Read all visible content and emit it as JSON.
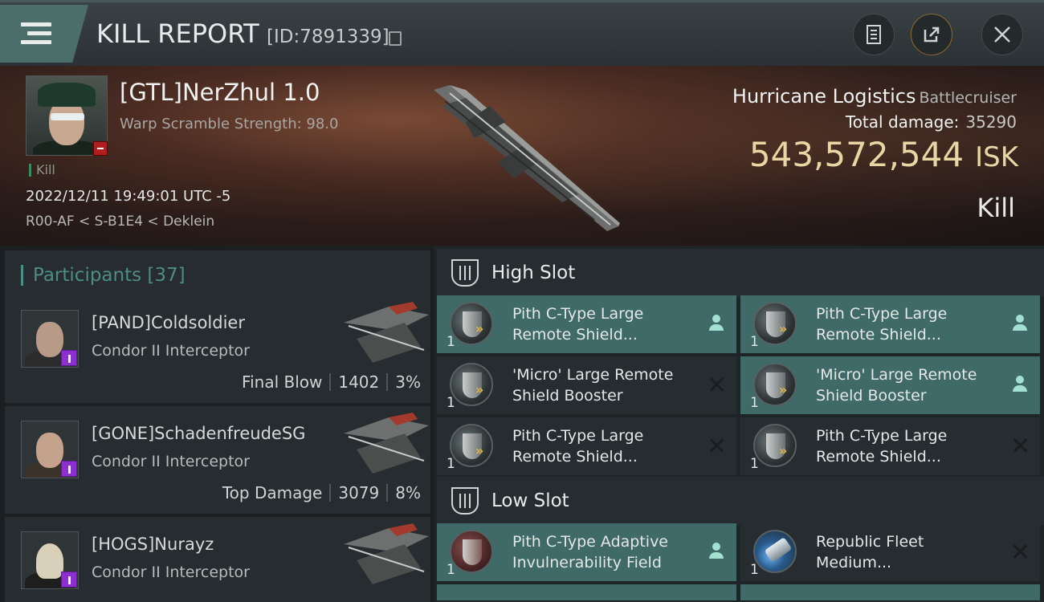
{
  "header": {
    "title": "KILL REPORT",
    "report_id": "[ID:7891339]",
    "buttons": [
      "clipboard-icon",
      "share-icon",
      "close-icon"
    ]
  },
  "victim": {
    "name": "[GTL]NerZhul 1.0",
    "subtitle": "Warp Scramble Strength: 98.0",
    "tag": "Kill",
    "datetime": "2022/12/11 19:49:01 UTC -5",
    "location": "R00-AF < S-B1E4 < Deklein",
    "ship_name": "Hurricane Logistics",
    "ship_class": "Battlecruiser",
    "total_damage_label": "Total damage:",
    "total_damage": "35290",
    "isk_value": "543,572,544",
    "isk_unit": "ISK",
    "result": "Kill"
  },
  "participants": {
    "label": "Participants",
    "count": "[37]",
    "rows": [
      {
        "name": "[PAND]Coldsoldier",
        "ship": "Condor II Interceptor",
        "stat_label": "Final Blow",
        "damage": "1402",
        "percent": "3%"
      },
      {
        "name": "[GONE]SchadenfreudeSG",
        "ship": "Condor II Interceptor",
        "stat_label": "Top Damage",
        "damage": "3079",
        "percent": "8%"
      },
      {
        "name": "[HOGS]Nurayz",
        "ship": "Condor II Interceptor",
        "stat_label": "",
        "damage": "",
        "percent": ""
      }
    ]
  },
  "modules": {
    "high_slot_label": "High Slot",
    "low_slot_label": "Low Slot",
    "high": [
      {
        "qty": "1",
        "line1": "Pith C-Type Large",
        "line2": "Remote Shield...",
        "status": "dropped",
        "icon": "shield-booster-icon"
      },
      {
        "qty": "1",
        "line1": "Pith C-Type Large",
        "line2": "Remote Shield...",
        "status": "dropped",
        "icon": "shield-booster-icon"
      },
      {
        "qty": "1",
        "line1": "'Micro' Large Remote",
        "line2": "Shield Booster",
        "status": "destroyed",
        "icon": "shield-booster-icon"
      },
      {
        "qty": "1",
        "line1": "'Micro' Large Remote",
        "line2": "Shield Booster",
        "status": "dropped",
        "icon": "shield-booster-icon"
      },
      {
        "qty": "1",
        "line1": "Pith C-Type Large",
        "line2": "Remote Shield...",
        "status": "destroyed",
        "icon": "shield-booster-icon"
      },
      {
        "qty": "1",
        "line1": "Pith C-Type Large",
        "line2": "Remote Shield...",
        "status": "destroyed",
        "icon": "shield-booster-icon"
      }
    ],
    "low": [
      {
        "qty": "1",
        "line1": "Pith C-Type Adaptive",
        "line2": "Invulnerability Field",
        "status": "dropped",
        "icon": "invulnerability-field-icon"
      },
      {
        "qty": "1",
        "line1": "Republic Fleet",
        "line2": "Medium...",
        "status": "destroyed",
        "icon": "capacitor-booster-icon"
      }
    ]
  }
}
